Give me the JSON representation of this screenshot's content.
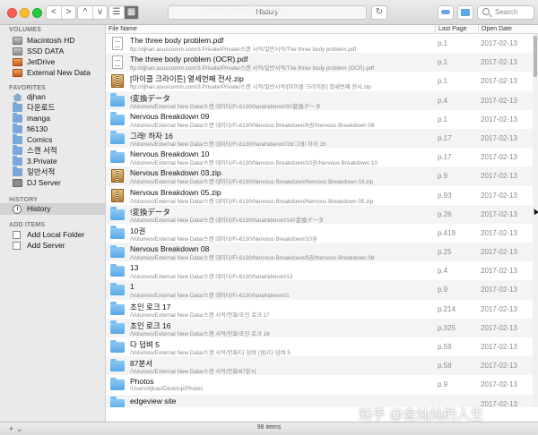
{
  "toolbar": {
    "back": "<",
    "forward": ">",
    "up": "^",
    "down": "v",
    "view_list": "☰",
    "view_grid": "▦",
    "title": "History",
    "refresh": "↻",
    "search_placeholder": "Search"
  },
  "watermark_top": "www.macjb.com",
  "watermark_bottom": "知乎 @金灿灿的人生",
  "sidebar": {
    "volumes_header": "VOLUMES",
    "volumes": [
      "Macintosh HD",
      "SSD DATA",
      "JetDrive",
      "External New Data"
    ],
    "favorites_header": "FAVORITES",
    "favorites": [
      "djhan",
      "다운로드",
      "manga",
      "fi6130",
      "Comics",
      "스캔 서적",
      "3.Private",
      "일반서적",
      "DJ Server"
    ],
    "history_header": "HISTORY",
    "history": [
      "History"
    ],
    "add_header": "ADD ITEMS",
    "add": [
      "Add Local Folder",
      "Add Server"
    ]
  },
  "table": {
    "col_name": "File Name",
    "col_page": "Last Page",
    "col_date": "Open Date",
    "rows": [
      {
        "icon": "pdf",
        "name": "The three body problem.pdf",
        "path": "ftp://djhan.asuscomm.com/3.Private/Private/스캔 서적/일반서적/The three body problem.pdf",
        "page": "p.1",
        "date": "2017-02-13"
      },
      {
        "icon": "pdf",
        "name": "The three body problem (OCR).pdf",
        "path": "ftp://djhan.asuscomm.com/3.Private/Private/스캔 서적/일반서적/The three body problem (OCR).pdf",
        "page": "p.1",
        "date": "2017-02-13"
      },
      {
        "icon": "zip",
        "name": "[마이클 크라이튼] 열세번째 전사.zip",
        "path": "ftp://djhan.asuscomm.com/3.Private/Private/스캔 서적/일반서적/[마이클 크라이튼] 열세번째 전사.zip",
        "page": "p.1",
        "date": "2017-02-13"
      },
      {
        "icon": "folder",
        "name": "!変換データ",
        "path": "/Volumes/External New Data/스캔 데이터/Fi-6130/harahidenori/9/!変換データ",
        "page": "p.4",
        "date": "2017-02-13"
      },
      {
        "icon": "folder",
        "name": "Nervous Breakdown 09",
        "path": "/Volumes/External New Data/스캔 데이터/Fi-6130/Nervous Breakdown/9권/Nervous Breakdown 09",
        "page": "p.1",
        "date": "2017-02-13"
      },
      {
        "icon": "folder",
        "name": "그래! 하자 16",
        "path": "/Volumes/External New Data/스캔 데이터/Fi-6130/harahidenori/16/그래! 하자 16",
        "page": "p.17",
        "date": "2017-02-13"
      },
      {
        "icon": "folder",
        "name": "Nervous Breakdown 10",
        "path": "/Volumes/External New Data/스캔 데이터/Fi-6130/Nervous Breakdown/10권/Nervous Breakdown 10",
        "page": "p.17",
        "date": "2017-02-13"
      },
      {
        "icon": "zip",
        "name": "Nervous Breakdown 03.zip",
        "path": "/Volumes/External New Data/스캔 데이터/Fi-6130/Nervous Breakdown/Nervous Breakdown 03.zip",
        "page": "p.9",
        "date": "2017-02-13"
      },
      {
        "icon": "zip",
        "name": "Nervous Breakdown 05.zip",
        "path": "/Volumes/External New Data/스캔 데이터/Fi-6130/Nervous Breakdown/Nervous Breakdown 05.zip",
        "page": "p.93",
        "date": "2017-02-13"
      },
      {
        "icon": "folder",
        "name": "!変換データ",
        "path": "/Volumes/External New Data/스캔 데이터/Fi-6130/harahidenori/14/!変換データ",
        "page": "p.26",
        "date": "2017-02-13"
      },
      {
        "icon": "folder",
        "name": "10권",
        "path": "/Volumes/External New Data/스캔 데이터/Fi-6130/Nervous Breakdown/10권",
        "page": "p.419",
        "date": "2017-02-13"
      },
      {
        "icon": "folder",
        "name": "Nervous Breakdown 08",
        "path": "/Volumes/External New Data/스캔 데이터/Fi-6130/Nervous Breakdown/8권/Nervous Breakdown 08",
        "page": "p.25",
        "date": "2017-02-13"
      },
      {
        "icon": "folder",
        "name": "13",
        "path": "/Volumes/External New Data/스캔 데이터/Fi-6130/harahidenori/13",
        "page": "p.4",
        "date": "2017-02-13"
      },
      {
        "icon": "folder",
        "name": "1",
        "path": "/Volumes/External New Data/스캔 데이터/Fi-6130/harahidenori/1",
        "page": "p.9",
        "date": "2017-02-13"
      },
      {
        "icon": "folder",
        "name": "초인 로크 17",
        "path": "/Volumes/External New Data/스캔 서적/만화/초인 로크 17",
        "page": "p.214",
        "date": "2017-02-13"
      },
      {
        "icon": "folder",
        "name": "초인 로크 16",
        "path": "/Volumes/External New Data/스캔 서적/만화/초인 로크 16",
        "page": "p.325",
        "date": "2017-02-13"
      },
      {
        "icon": "folder",
        "name": "다 덤벼 5",
        "path": "/Volumes/External New Data/스캔 서적/만화/다 덤벼 (원)/다 덤벼 5",
        "page": "p.59",
        "date": "2017-02-13"
      },
      {
        "icon": "folder",
        "name": "87분서",
        "path": "/Volumes/External New Data/스캔 서적/만화/87분서",
        "page": "p.58",
        "date": "2017-02-13"
      },
      {
        "icon": "folder",
        "name": "Photos",
        "path": "/Users/djhan/Desktop/Photos",
        "page": "p.9",
        "date": "2017-02-13"
      },
      {
        "icon": "folder",
        "name": "edgeview site",
        "path": "",
        "page": "",
        "date": "2017-02-13"
      }
    ]
  },
  "footer": {
    "add_label": "+",
    "add_menu": "⌄",
    "count": "96 items"
  }
}
